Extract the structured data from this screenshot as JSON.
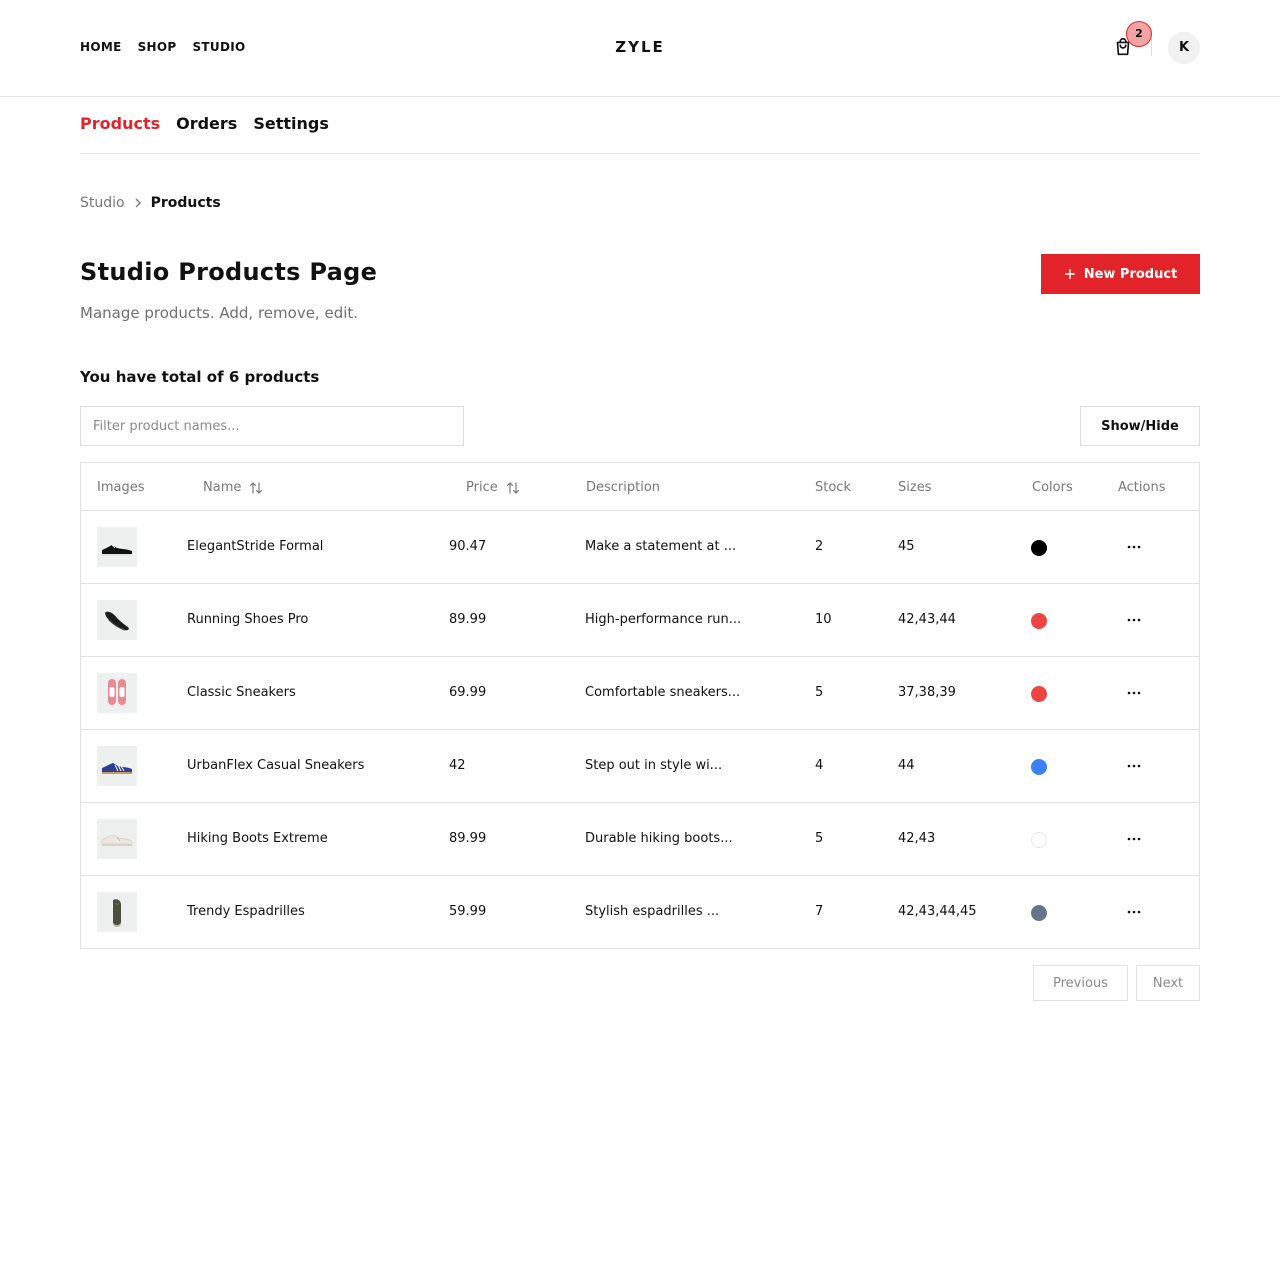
{
  "header": {
    "nav": [
      "HOME",
      "SHOP",
      "STUDIO"
    ],
    "brand": "ZYLE",
    "cart_count": "2",
    "avatar_initial": "K"
  },
  "tabs": [
    {
      "label": "Products",
      "active": true
    },
    {
      "label": "Orders",
      "active": false
    },
    {
      "label": "Settings",
      "active": false
    }
  ],
  "breadcrumb": {
    "parent": "Studio",
    "current": "Products"
  },
  "page": {
    "title": "Studio Products Page",
    "subtitle": "Manage products. Add, remove, edit.",
    "new_button": "New Product",
    "count_text": "You have total of 6 products"
  },
  "filter": {
    "placeholder": "Filter product names...",
    "value": ""
  },
  "show_hide_label": "Show/Hide",
  "columns": [
    "Images",
    "Name",
    "Price",
    "Description",
    "Stock",
    "Sizes",
    "Colors",
    "Actions"
  ],
  "products": [
    {
      "name": "ElegantStride Formal",
      "price": "90.47",
      "description": "Make a statement at ...",
      "stock": "2",
      "sizes": "45",
      "color": "#000000",
      "thumb": "black-shoe"
    },
    {
      "name": "Running Shoes Pro",
      "price": "89.99",
      "description": "High-performance run...",
      "stock": "10",
      "sizes": "42,43,44",
      "color": "#ef4444",
      "thumb": "dark-runner"
    },
    {
      "name": "Classic Sneakers",
      "price": "69.99",
      "description": "Comfortable sneakers...",
      "stock": "5",
      "sizes": "37,38,39",
      "color": "#ef4444",
      "thumb": "pink-pair"
    },
    {
      "name": "UrbanFlex Casual Sneakers",
      "price": "42",
      "description": "Step out in style wi...",
      "stock": "4",
      "sizes": "44",
      "color": "#3b82f6",
      "thumb": "blue-sneaker"
    },
    {
      "name": "Hiking Boots Extreme",
      "price": "89.99",
      "description": "Durable hiking boots...",
      "stock": "5",
      "sizes": "42,43",
      "color": "#ffffff",
      "thumb": "white-sneaker"
    },
    {
      "name": "Trendy Espadrilles",
      "price": "59.99",
      "description": "Stylish espadrilles ...",
      "stock": "7",
      "sizes": "42,43,44,45",
      "color": "#64748b",
      "thumb": "olive-shoe"
    }
  ],
  "pagination": {
    "previous": "Previous",
    "next": "Next"
  },
  "colors": {
    "accent": "#e2242a",
    "border": "#e2e2e2",
    "muted_text": "#777777"
  }
}
